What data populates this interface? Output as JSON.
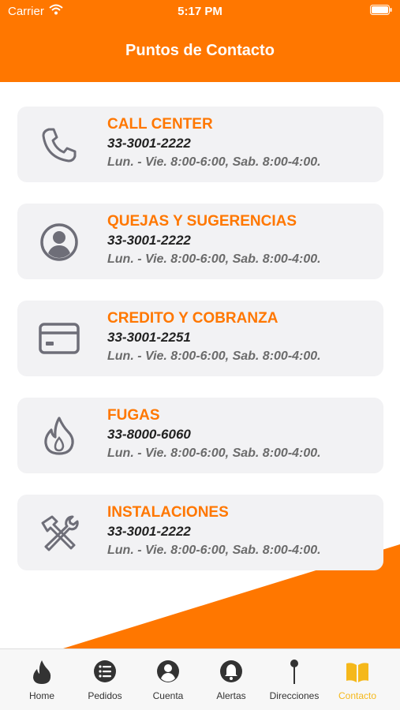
{
  "status_bar": {
    "carrier": "Carrier",
    "time": "5:17 PM"
  },
  "header": {
    "title": "Puntos de Contacto"
  },
  "colors": {
    "accent": "#FF7700",
    "active_tab": "#F5B81B",
    "icon_gray": "#6E6E78",
    "tab_icon": "#333333"
  },
  "contacts": [
    {
      "title": "CALL CENTER",
      "phone": "33-3001-2222",
      "hours": "Lun. - Vie. 8:00-6:00, Sab. 8:00-4:00.",
      "icon": "phone-icon"
    },
    {
      "title": "QUEJAS Y SUGERENCIAS",
      "phone": "33-3001-2222",
      "hours": "Lun. - Vie. 8:00-6:00, Sab. 8:00-4:00.",
      "icon": "user-circle-icon"
    },
    {
      "title": "CREDITO Y COBRANZA",
      "phone": "33-3001-2251",
      "hours": "Lun. - Vie. 8:00-6:00, Sab. 8:00-4:00.",
      "icon": "credit-card-icon"
    },
    {
      "title": "FUGAS",
      "phone": "33-8000-6060",
      "hours": "Lun. - Vie. 8:00-6:00, Sab. 8:00-4:00.",
      "icon": "flame-icon"
    },
    {
      "title": "INSTALACIONES",
      "phone": "33-3001-2222",
      "hours": "Lun. - Vie. 8:00-6:00, Sab. 8:00-4:00.",
      "icon": "tools-icon"
    }
  ],
  "tabbar": {
    "tabs": [
      {
        "label": "Home",
        "icon": "flame-icon"
      },
      {
        "label": "Pedidos",
        "icon": "list-icon"
      },
      {
        "label": "Cuenta",
        "icon": "account-icon"
      },
      {
        "label": "Alertas",
        "icon": "bell-icon"
      },
      {
        "label": "Direcciones",
        "icon": "pin-icon"
      },
      {
        "label": "Contacto",
        "icon": "book-icon"
      }
    ],
    "active": "Contacto"
  }
}
